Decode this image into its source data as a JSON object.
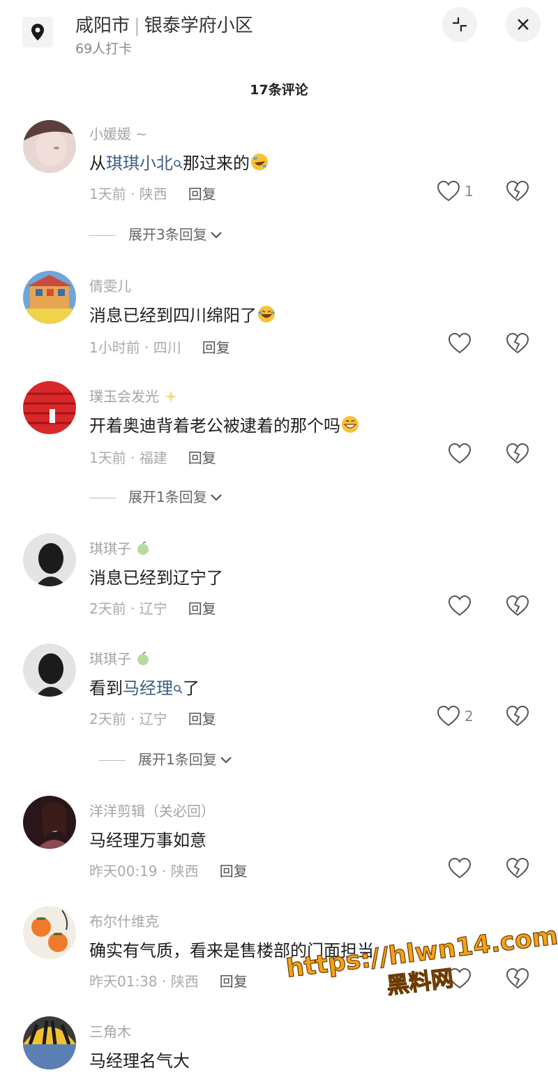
{
  "header": {
    "city": "咸阳市",
    "place": "银泰学府小区",
    "checkins": "69人打卡"
  },
  "comments_title": "17条评论",
  "comments": [
    {
      "user": "小媛媛 ~",
      "text_pre": "从",
      "link": "琪琪小北",
      "text_post": "那过来的",
      "emoji": "rofl-emoji",
      "meta": "1天前 · 陕西",
      "reply": "回复",
      "likes": "1",
      "expand": "展开3条回复"
    },
    {
      "user": "倩雯儿",
      "text_pre": "消息已经到四川绵阳了",
      "emoji": "laugh-cry-emoji",
      "meta": "1小时前 · 四川",
      "reply": "回复"
    },
    {
      "user": "璞玉会发光",
      "user_emoji": "sparkles-icon",
      "text_pre": "开着奥迪背着老公被逮着的那个吗",
      "emoji": "grin-emoji",
      "meta": "1天前 · 福建",
      "reply": "回复",
      "expand": "展开1条回复"
    },
    {
      "user": "琪琪子",
      "user_emoji": "green-fruit-icon",
      "text_pre": "消息已经到辽宁了",
      "meta": "2天前 · 辽宁",
      "reply": "回复"
    },
    {
      "user": "琪琪子",
      "user_emoji": "green-fruit-icon",
      "text_pre": "看到",
      "link": "马经理",
      "text_post": "了",
      "meta": "2天前 · 辽宁",
      "reply": "回复",
      "likes": "2",
      "expand": "展开1条回复"
    },
    {
      "user": "洋洋剪辑（关必回）",
      "text_pre": "马经理万事如意",
      "meta": "昨天00:19 · 陕西",
      "reply": "回复"
    },
    {
      "user": "布尔什维克",
      "text_pre": "确实有气质，看来是售楼部的门面担当",
      "meta": "昨天01:38 · 陕西",
      "reply": "回复"
    },
    {
      "user": "三角木",
      "text_pre": "马经理名气大"
    }
  ],
  "watermark": {
    "line1": "https://hlwn14.com",
    "line2": "黑料网"
  },
  "colors": {
    "link": "#3b5f86",
    "watermark": "#f4a11a",
    "meta": "#aaaaaa"
  }
}
